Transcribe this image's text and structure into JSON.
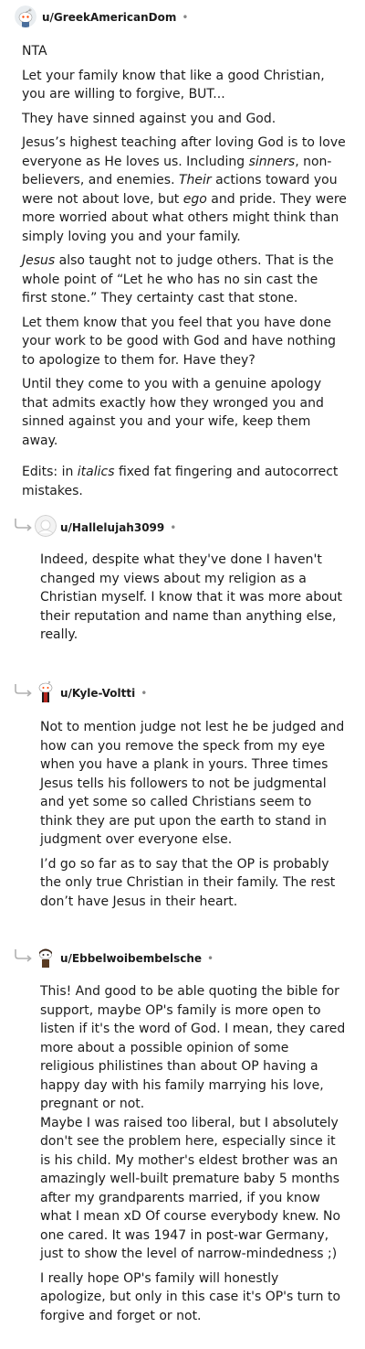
{
  "comments": [
    {
      "author": "u/GreekAmericanDom",
      "dot": "•",
      "paragraphs": [
        "NTA",
        "Let your family know that like a good Christian, you are willing to forgive, BUT...",
        "They have sinned against you and God."
      ],
      "p4": {
        "a": "Jesus’s highest teaching after loving God is to love everyone as He loves us. Including ",
        "b": "sinners",
        "c": ", non-believers, and enemies. ",
        "d": "Their",
        "e": " actions toward you were not about love, but ",
        "f": "ego",
        "g": " and pride. They were more worried about what others might think than simply loving you and your family."
      },
      "p5": {
        "a": "Jesus",
        "b": " also taught not to judge others. That is the whole point of “Let he who has no sin cast the first stone.” They certainty cast that stone."
      },
      "p6": "Let them know that you feel that you have done your work to be good with God and have nothing to apologize to them for. Have they?",
      "p7": "Until they come to you with a genuine apology that admits exactly how they wronged you and sinned against you and your wife, keep them away.",
      "edits": {
        "a": "Edits: in ",
        "b": "italics",
        "c": " fixed fat fingering and autocorrect mistakes."
      }
    },
    {
      "author": "u/Hallelujah3099",
      "dot": "•",
      "paragraphs": [
        "Indeed, despite what they've done I haven't changed my views about my religion as a Christian myself. I know that it was more about their reputation and name than anything else, really."
      ]
    },
    {
      "author": "u/Kyle-Voltti",
      "dot": "•",
      "paragraphs": [
        "Not to mention judge not lest he be judged and how can you remove the speck from my eye when you have a plank in yours. Three times Jesus tells his followers to not be judgmental and yet some so called Christians seem to think they are put upon the earth to stand in judgment over everyone else.",
        "I’d go so far as to say that the OP is probably the only true Christian in their family. The rest don’t have Jesus in their heart."
      ]
    },
    {
      "author": "u/Ebbelwoibembelsche",
      "dot": "•",
      "paragraphs": [
        "This! And good to be able quoting the bible for support, maybe OP's family is more open to listen if it's the word of God. I mean, they cared more about a possible opinion of some religious philistines than about OP having a happy day with his family marrying his love, pregnant or not.",
        "Maybe I was raised too liberal, but I absolutely don't see the problem here, especially since it is his child. My mother's eldest brother was an amazingly well-built premature baby 5 months after my grandparents married, if you know what I mean xD Of course everybody knew. No one cared. It was 1947 in post-war Germany, just to show the level of narrow-mindedness ;)",
        "I really hope OP's family will honestly apologize, but only in this case it's OP's turn to forgive and forget or not."
      ]
    }
  ]
}
